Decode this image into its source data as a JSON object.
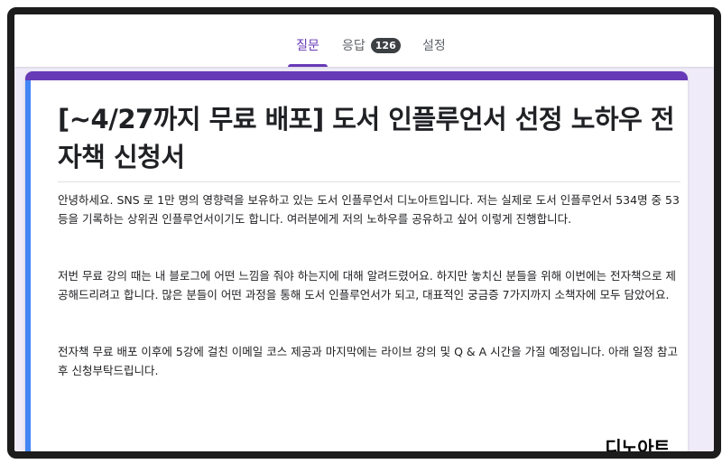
{
  "tabs": {
    "questions_label": "질문",
    "responses_label": "응답",
    "responses_count": "126",
    "settings_label": "설정"
  },
  "form": {
    "title": "[~4/27까지 무료 배포] 도서 인플루언서 선정 노하우 전자책 신청서",
    "description": [
      "안녕하세요. SNS 로 1만 명의 영향력을 보유하고 있는 도서 인플루언서 디노아트입니다. 저는 실제로 도서 인플루언서 534명 중 53등을 기록하는 상위권 인플루언서이기도 합니다. 여러분에게 저의 노하우를 공유하고 싶어 이렇게 진행합니다.",
      "저번 무료 강의 때는 내 블로그에 어떤 느낌을 줘야 하는지에 대해 알려드렸어요. 하지만 놓치신 분들을 위해 이번에는 전자책으로 제공해드리려고 합니다. 많은 분들이 어떤 과정을 통해 도서 인플루언서가 되고, 대표적인 궁금증 7가지까지 소책자에 모두 담았어요.",
      "전자책 무료 배포 이후에 5강에 걸친 이메일 코스 제공과 마지막에는 라이브 강의 및 Q & A 시간을 가질 예정입니다. 아래 일정 참고 후 신청부탁드립니다."
    ]
  },
  "watermark": {
    "text": "디노아트"
  },
  "colors": {
    "accent": "#673ab7",
    "left_accent": "#4285f4",
    "background": "#f0ebf8",
    "badge": "#3c4043"
  }
}
